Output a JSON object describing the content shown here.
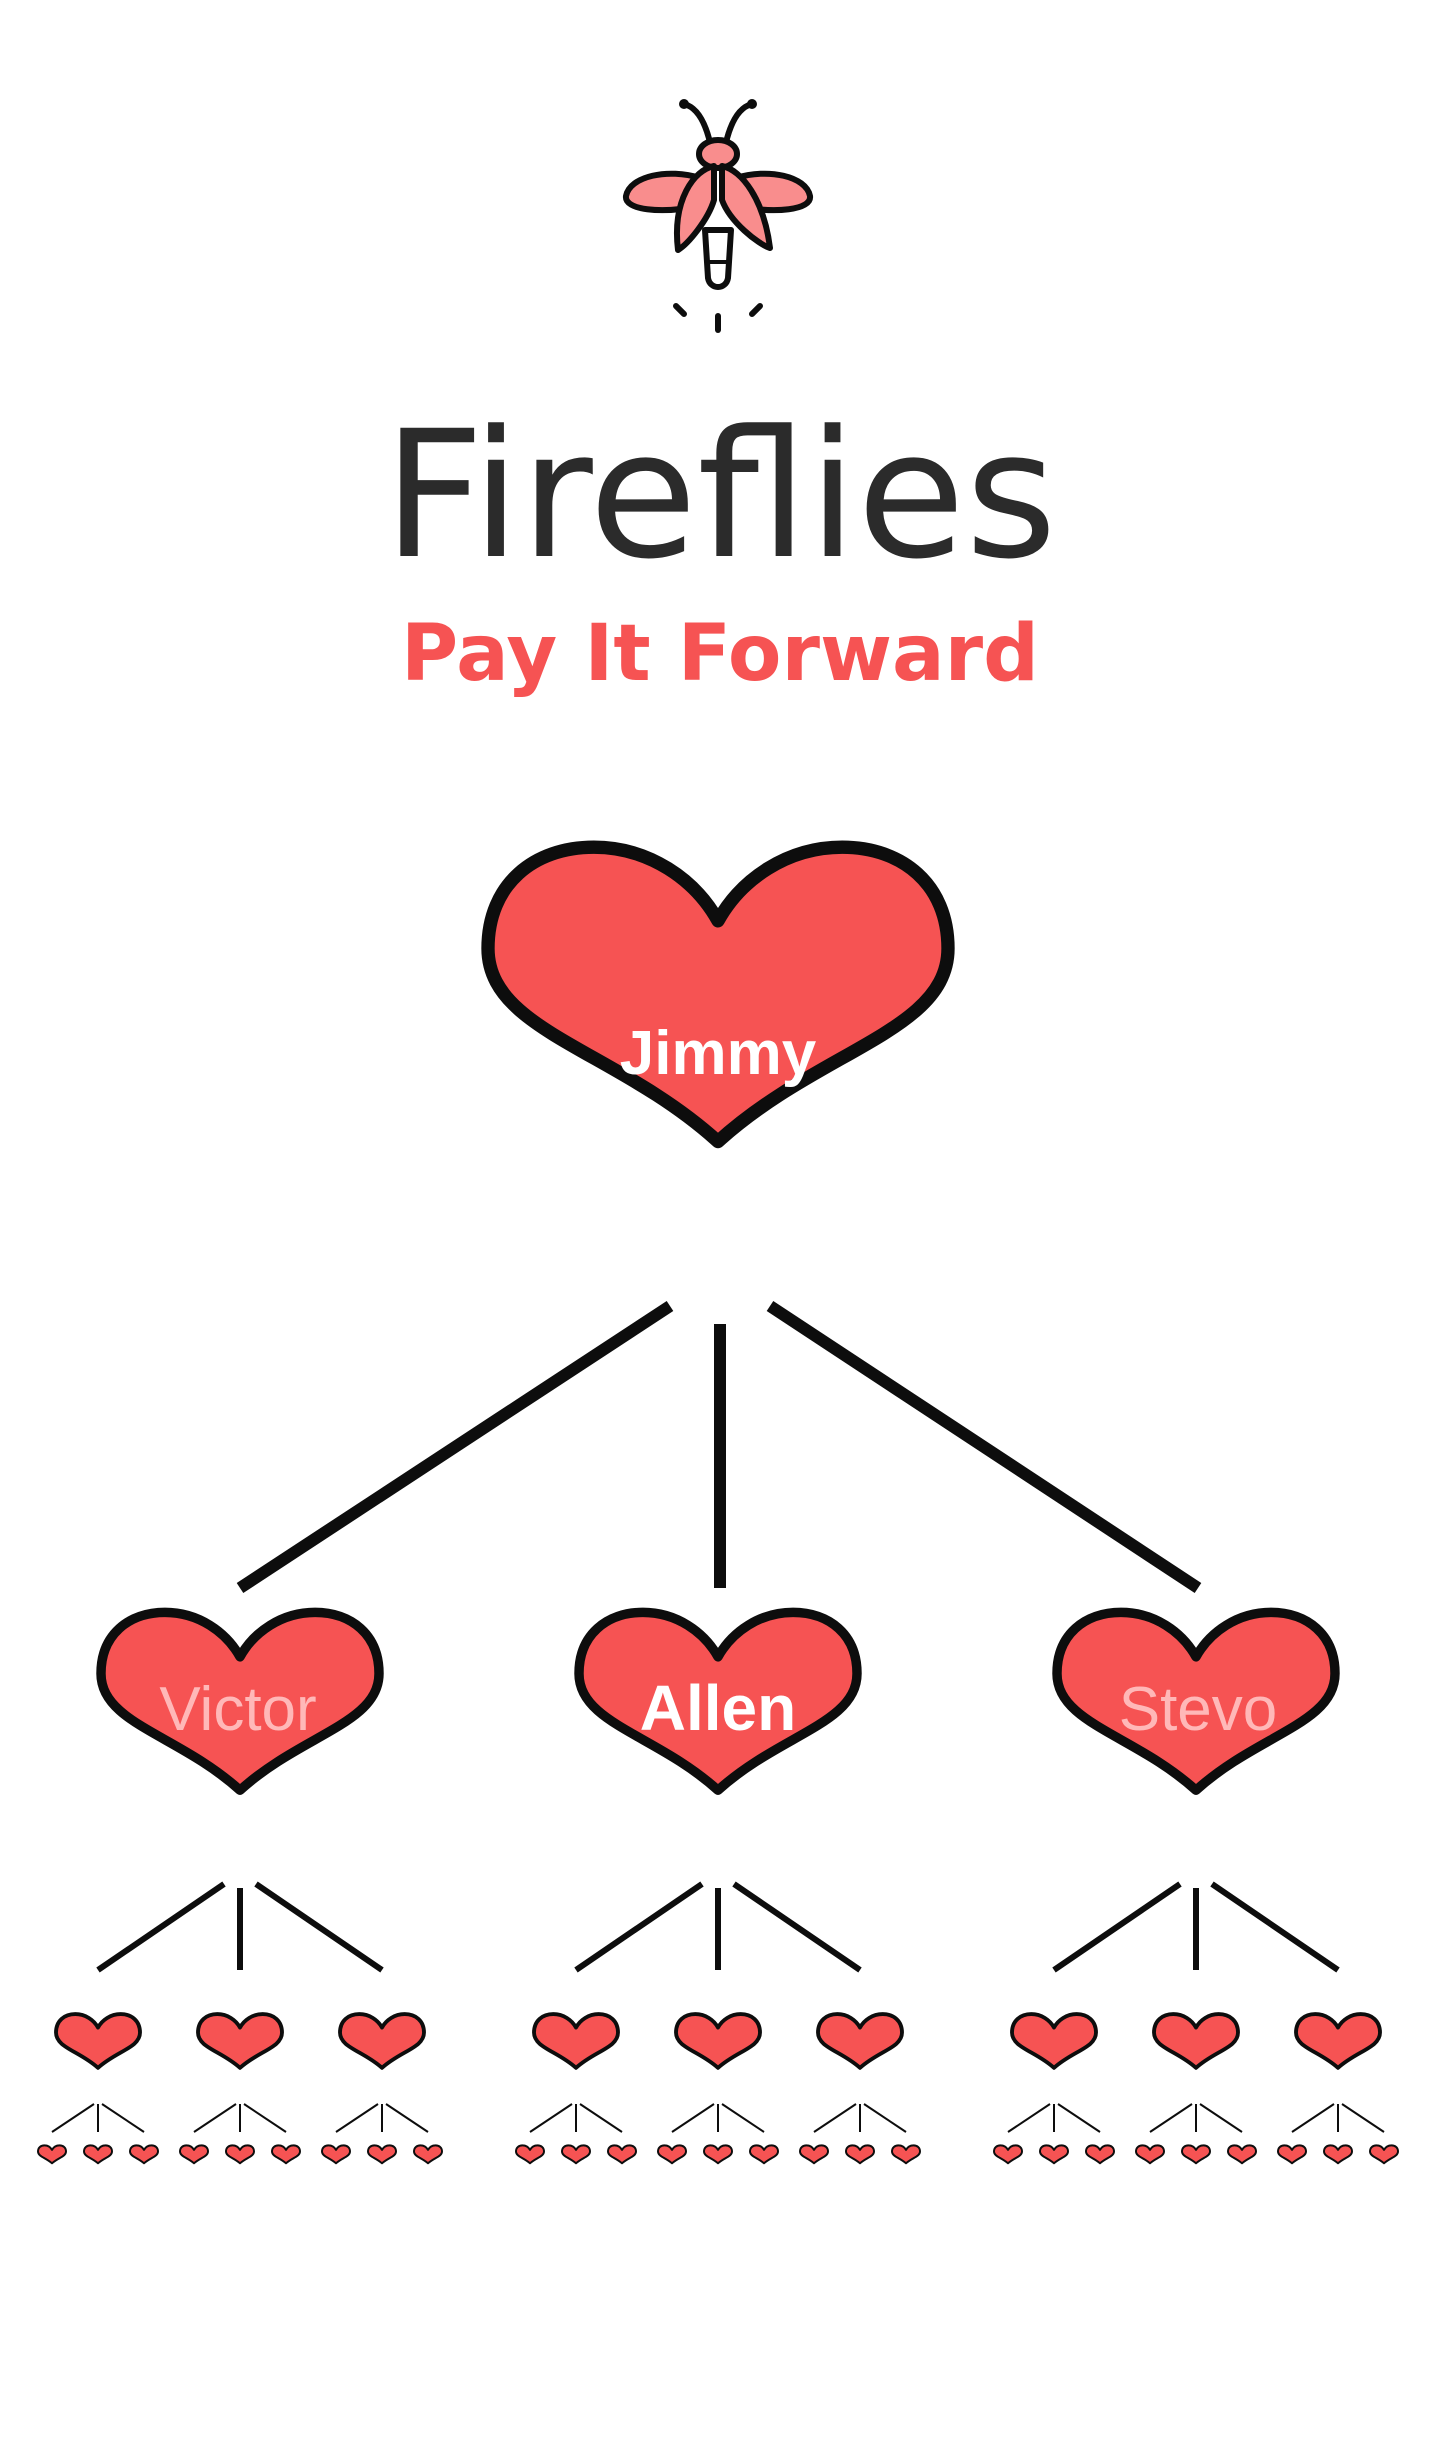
{
  "app": {
    "title": "Fireflies",
    "subtitle": "Pay It Forward"
  },
  "logo": {
    "icon": "firefly-icon"
  },
  "colors": {
    "heart_fill": "#F65353",
    "outline": "#0D0D0D",
    "title_text": "#2B2B2B",
    "accent": "#F65353",
    "label_active": "#FFFFFF",
    "label_inactive": "#FFB8B8"
  },
  "tree": {
    "root": {
      "name": "Jimmy",
      "active": true
    },
    "children": [
      {
        "name": "Victor",
        "active": false
      },
      {
        "name": "Allen",
        "active": true
      },
      {
        "name": "Stevo",
        "active": false
      }
    ]
  }
}
